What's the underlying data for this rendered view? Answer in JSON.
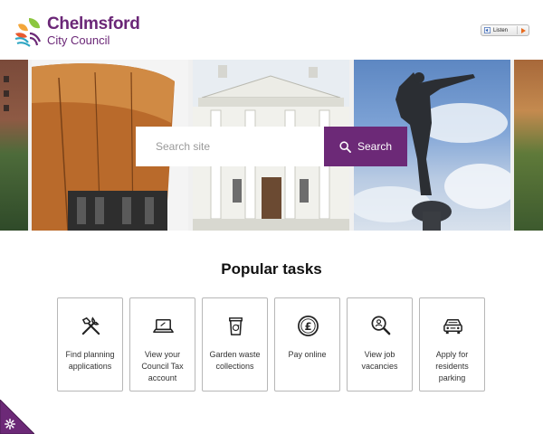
{
  "header": {
    "logo": {
      "line1": "Chelmsford",
      "line2": "City Council"
    },
    "listen_label": "Listen"
  },
  "search": {
    "placeholder": "Search site",
    "button_label": "Search",
    "button_icon": "search-icon"
  },
  "tasks": {
    "title": "Popular tasks",
    "items": [
      {
        "label": "Find planning applications",
        "icon": "tools-icon"
      },
      {
        "label": "View your Council Tax account",
        "icon": "laptop-icon"
      },
      {
        "label": "Garden waste collections",
        "icon": "recycling-bin-icon"
      },
      {
        "label": "Pay online",
        "icon": "pound-coin-icon"
      },
      {
        "label": "View job vacancies",
        "icon": "magnifier-person-icon"
      },
      {
        "label": "Apply for residents parking",
        "icon": "car-icon"
      }
    ]
  },
  "colors": {
    "brand": "#6c2977",
    "accent_green": "#8cc63f",
    "accent_teal": "#2fa6c3",
    "listen_play": "#e86b1f"
  },
  "accessibility_widget_icon": "gear-icon"
}
